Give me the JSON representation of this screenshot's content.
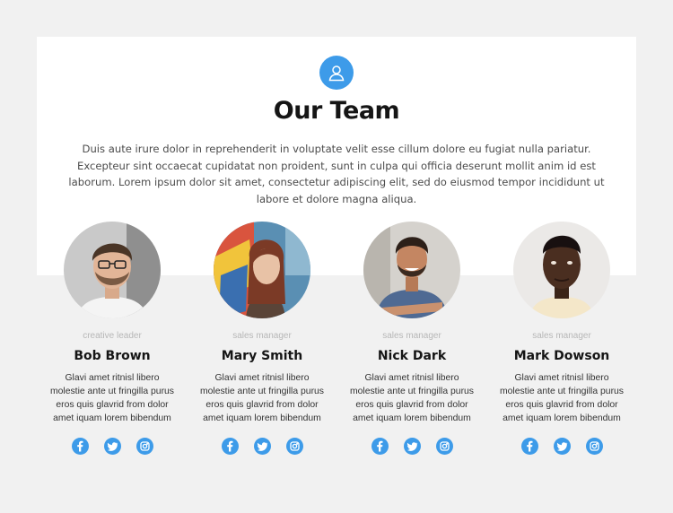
{
  "header": {
    "icon": "user-icon",
    "title": "Our Team",
    "intro": "Duis aute irure dolor in reprehenderit in voluptate velit esse cillum dolore eu fugiat nulla pariatur. Excepteur sint occaecat cupidatat non proident, sunt in culpa qui officia deserunt mollit anim id est laborum. Lorem ipsum dolor sit amet, consectetur adipiscing elit, sed do eiusmod tempor incididunt ut labore et dolore magna aliqua."
  },
  "members": [
    {
      "role": "creative leader",
      "name": "Bob Brown",
      "bio": "Glavi amet ritnisl libero molestie ante ut fringilla purus eros quis glavrid from dolor amet iquam lorem bibendum"
    },
    {
      "role": "sales manager",
      "name": "Mary Smith",
      "bio": "Glavi amet ritnisl libero molestie ante ut fringilla purus eros quis glavrid from dolor amet iquam lorem bibendum"
    },
    {
      "role": "sales manager",
      "name": "Nick Dark",
      "bio": "Glavi amet ritnisl libero molestie ante ut fringilla purus eros quis glavrid from dolor amet iquam lorem bibendum"
    },
    {
      "role": "sales manager",
      "name": "Mark Dowson",
      "bio": "Glavi amet ritnisl libero molestie ante ut fringilla purus eros quis glavrid from dolor amet iquam lorem bibendum"
    }
  ],
  "social_icons": [
    "facebook-icon",
    "twitter-icon",
    "instagram-icon"
  ],
  "colors": {
    "accent": "#3d9be9",
    "background": "#f1f1f1",
    "panel": "#ffffff",
    "title": "#151515",
    "muted": "#b7b7b7"
  }
}
